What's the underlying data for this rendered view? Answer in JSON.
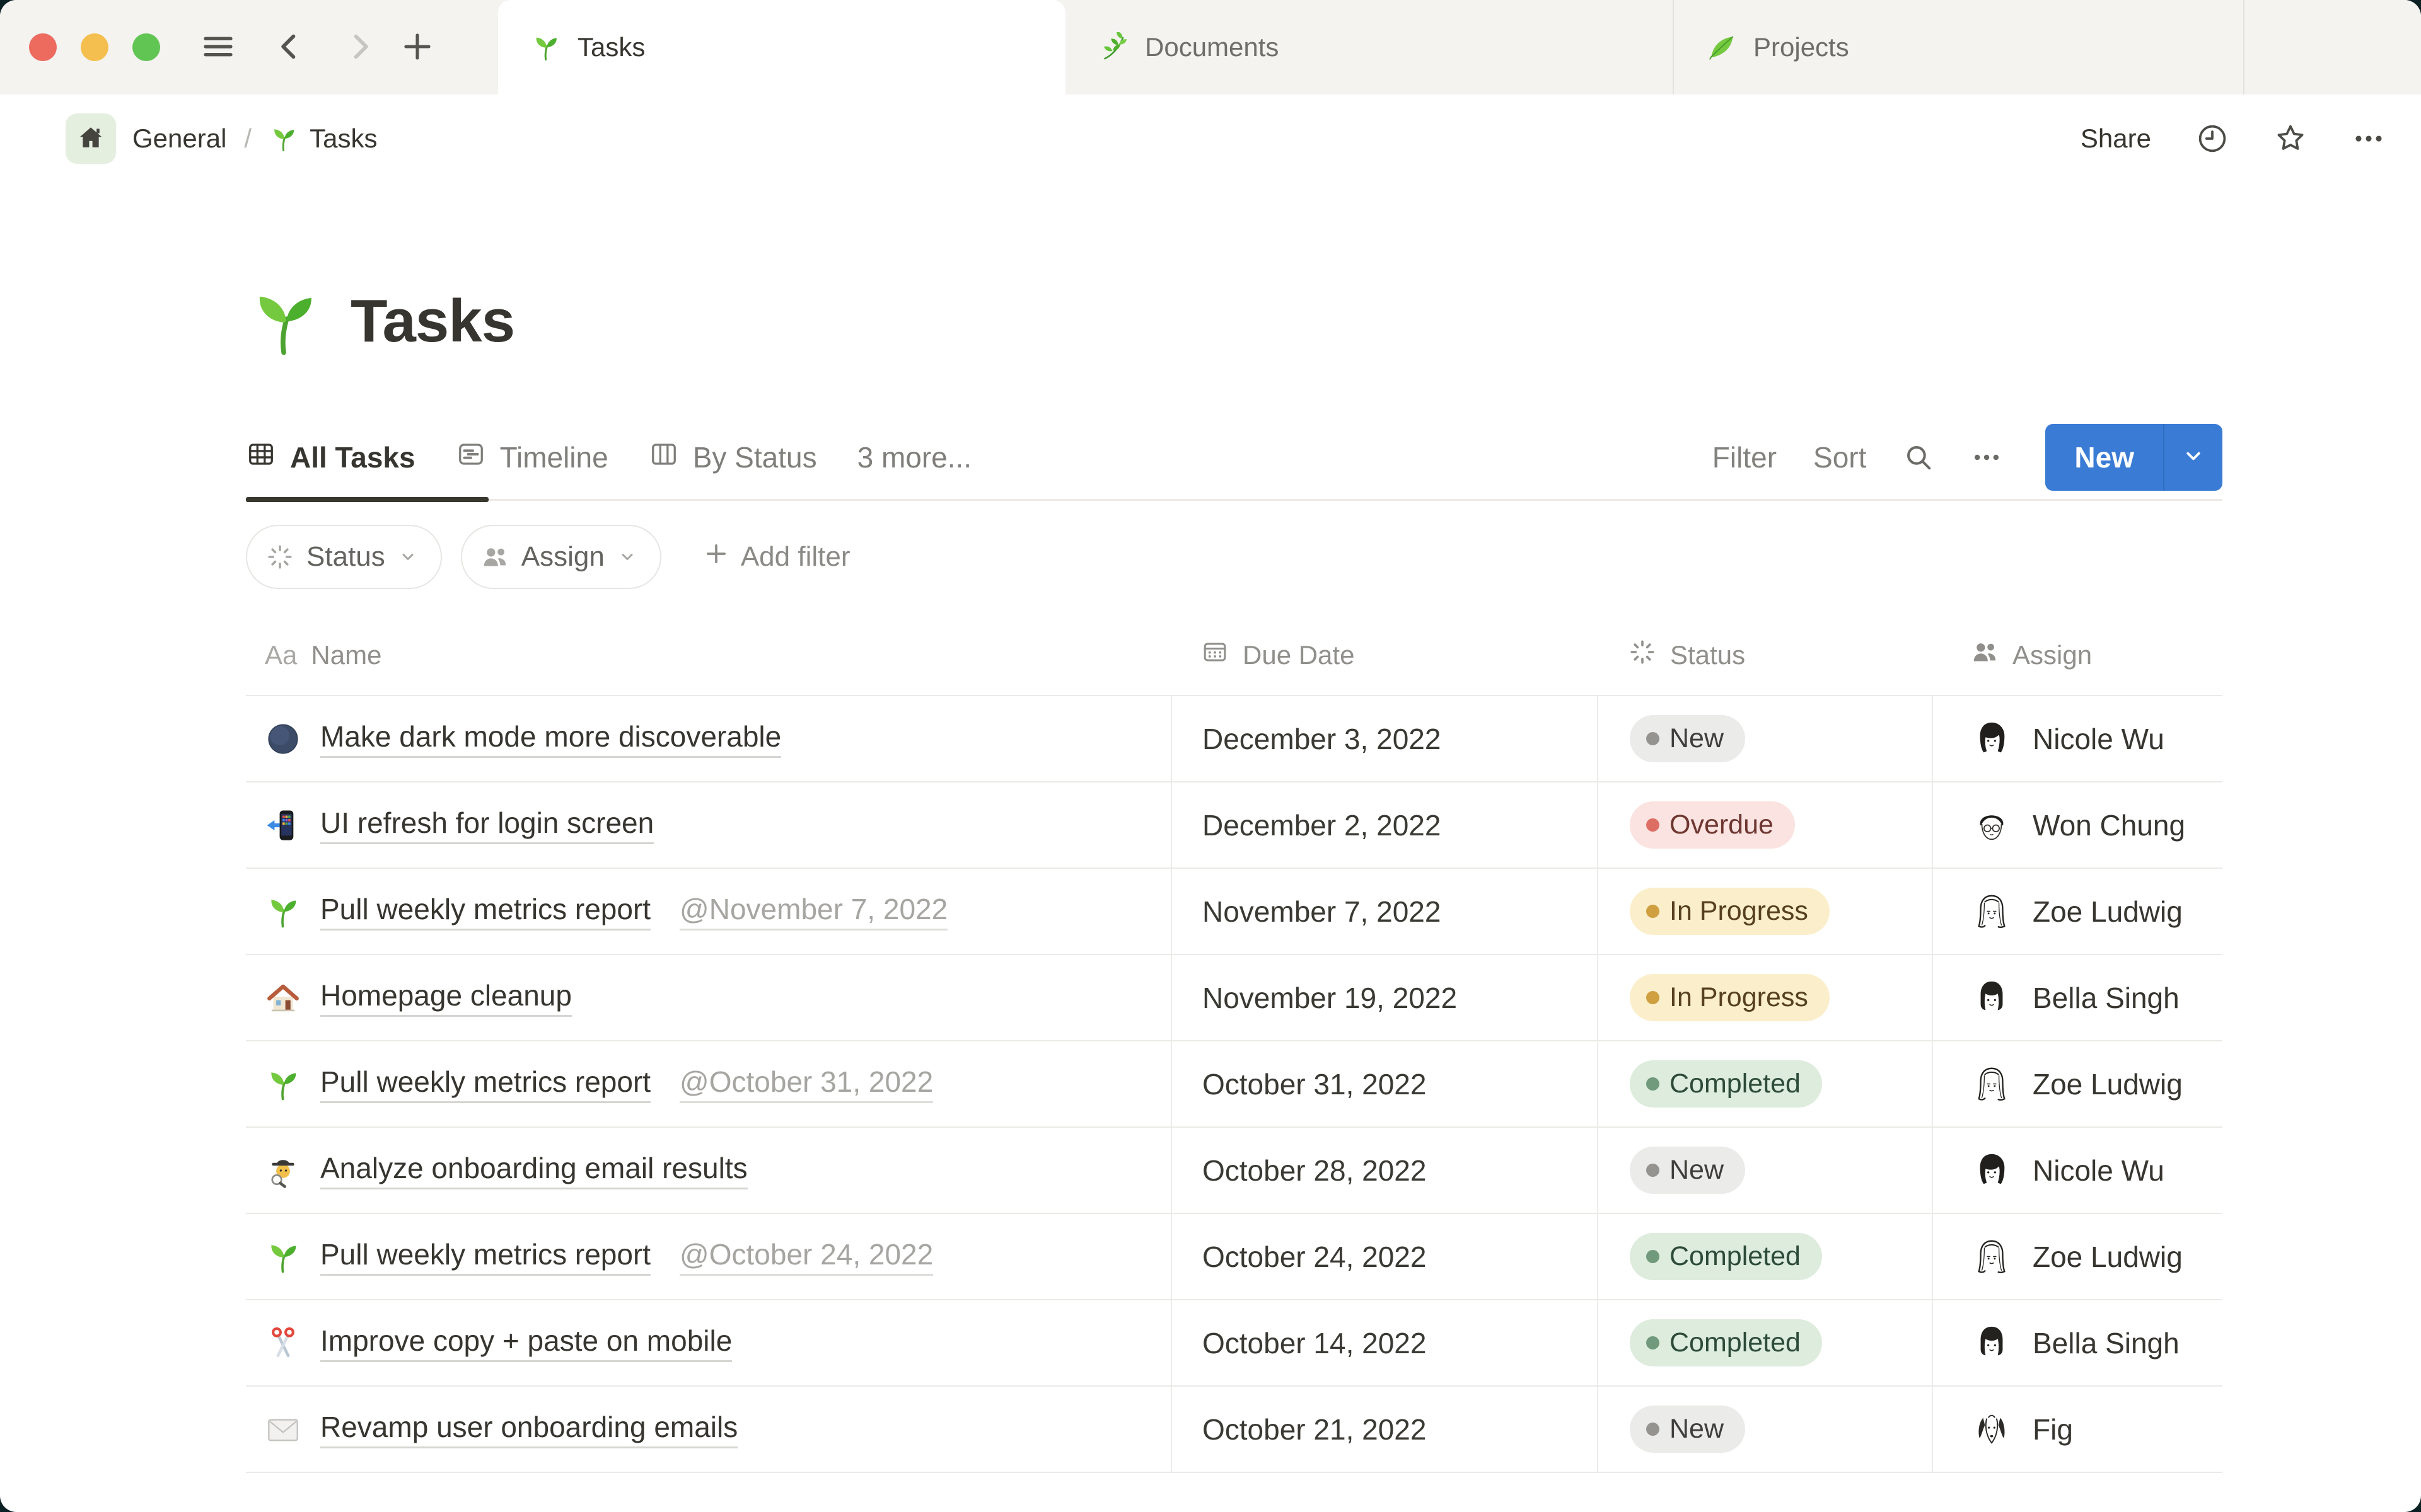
{
  "window": {
    "traffic_lights": {
      "close": "#ec6a5e",
      "minimize": "#f5bf4f",
      "zoom": "#61c554"
    },
    "tabs": [
      {
        "label": "Tasks",
        "icon": "seedling",
        "active": true
      },
      {
        "label": "Documents",
        "icon": "herb",
        "active": false
      },
      {
        "label": "Projects",
        "icon": "leaf",
        "active": false
      }
    ]
  },
  "breadcrumb": {
    "workspace": "General",
    "separator": "/",
    "page_icon": "seedling",
    "page": "Tasks"
  },
  "topbar_actions": {
    "share_label": "Share",
    "icons": [
      "clock-icon",
      "star-icon",
      "more-icon"
    ]
  },
  "page": {
    "icon": "seedling",
    "title": "Tasks"
  },
  "toolbar": {
    "views": [
      {
        "label": "All Tasks",
        "icon": "table",
        "active": true
      },
      {
        "label": "Timeline",
        "icon": "timeline",
        "active": false
      },
      {
        "label": "By Status",
        "icon": "board",
        "active": false
      }
    ],
    "more_label": "3 more...",
    "filter_label": "Filter",
    "sort_label": "Sort",
    "new_label": "New"
  },
  "filter_bar": {
    "chips": [
      {
        "label": "Status",
        "icon": "status"
      },
      {
        "label": "Assign",
        "icon": "people"
      }
    ],
    "add_filter_label": "Add filter"
  },
  "table": {
    "columns": [
      {
        "label": "Name",
        "icon": "aa"
      },
      {
        "label": "Due Date",
        "icon": "calendar"
      },
      {
        "label": "Status",
        "icon": "status"
      },
      {
        "label": "Assign",
        "icon": "people"
      }
    ],
    "rows": [
      {
        "icon": "new-moon",
        "name": "Make dark mode more discoverable",
        "mention": "",
        "due": "December 3, 2022",
        "status": "New",
        "assignee": "Nicole Wu",
        "avatar": "nicole"
      },
      {
        "icon": "phone",
        "name": "UI refresh for login screen",
        "mention": "",
        "due": "December 2, 2022",
        "status": "Overdue",
        "assignee": "Won Chung",
        "avatar": "won"
      },
      {
        "icon": "seedling",
        "name": "Pull weekly metrics report",
        "mention": "@November 7, 2022",
        "due": "November 7, 2022",
        "status": "In Progress",
        "assignee": "Zoe Ludwig",
        "avatar": "zoe"
      },
      {
        "icon": "house",
        "name": "Homepage cleanup",
        "mention": "",
        "due": "November 19, 2022",
        "status": "In Progress",
        "assignee": "Bella Singh",
        "avatar": "bella"
      },
      {
        "icon": "seedling",
        "name": "Pull weekly metrics report",
        "mention": "@October 31, 2022",
        "due": "October 31, 2022",
        "status": "Completed",
        "assignee": "Zoe Ludwig",
        "avatar": "zoe"
      },
      {
        "icon": "detective",
        "name": "Analyze onboarding email results",
        "mention": "",
        "due": "October 28, 2022",
        "status": "New",
        "assignee": "Nicole Wu",
        "avatar": "nicole"
      },
      {
        "icon": "seedling",
        "name": "Pull weekly metrics report",
        "mention": "@October 24, 2022",
        "due": "October 24, 2022",
        "status": "Completed",
        "assignee": "Zoe Ludwig",
        "avatar": "zoe"
      },
      {
        "icon": "scissors",
        "name": "Improve copy + paste on mobile",
        "mention": "",
        "due": "October 14, 2022",
        "status": "Completed",
        "assignee": "Bella Singh",
        "avatar": "bella"
      },
      {
        "icon": "envelope",
        "name": "Revamp user onboarding emails",
        "mention": "",
        "due": "October 21, 2022",
        "status": "New",
        "assignee": "Fig",
        "avatar": "fig"
      }
    ]
  },
  "status_colors": {
    "New": {
      "background": "#ebebe9",
      "dot": "#949390",
      "text": "#3f3e3a"
    },
    "Overdue": {
      "background": "#fae3e0",
      "dot": "#dd6e64",
      "text": "#6e3630"
    },
    "In Progress": {
      "background": "#fbeecb",
      "dot": "#cf9f40",
      "text": "#56401f"
    },
    "Completed": {
      "background": "#ddecdd",
      "dot": "#71997c",
      "text": "#2d4b38"
    }
  },
  "accent": {
    "new_button": "#3a7cd5"
  }
}
